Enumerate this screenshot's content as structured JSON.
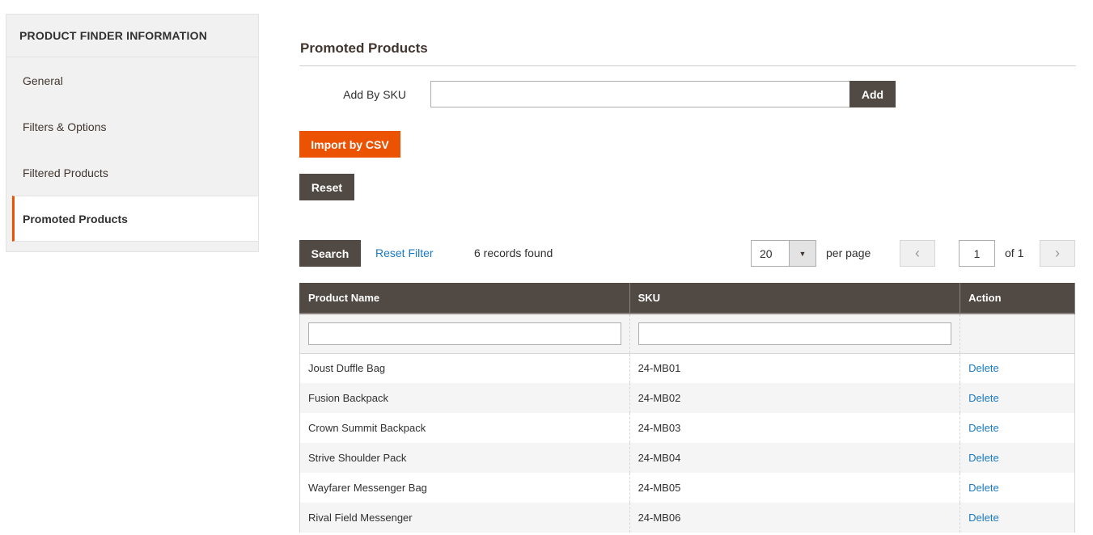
{
  "sidebar": {
    "title": "PRODUCT FINDER INFORMATION",
    "items": [
      {
        "label": "General"
      },
      {
        "label": "Filters & Options"
      },
      {
        "label": "Filtered Products"
      },
      {
        "label": "Promoted Products",
        "active": true
      }
    ]
  },
  "main": {
    "title": "Promoted Products",
    "add_by_sku_label": "Add By SKU",
    "sku_input_value": "",
    "add_button": "Add",
    "import_button": "Import by CSV",
    "reset_button": "Reset"
  },
  "toolbar": {
    "search_button": "Search",
    "reset_filter_link": "Reset Filter",
    "records_found": "6 records found",
    "per_page_value": "20",
    "per_page_label": "per page",
    "prev_icon": "‹",
    "next_icon": "›",
    "current_page": "1",
    "page_total": "of 1"
  },
  "grid": {
    "columns": [
      "Product Name",
      "SKU",
      "Action"
    ],
    "filters": {
      "product_name": "",
      "sku": ""
    },
    "rows": [
      {
        "name": "Joust Duffle Bag",
        "sku": "24-MB01",
        "action": "Delete"
      },
      {
        "name": "Fusion Backpack",
        "sku": "24-MB02",
        "action": "Delete"
      },
      {
        "name": "Crown Summit Backpack",
        "sku": "24-MB03",
        "action": "Delete"
      },
      {
        "name": "Strive Shoulder Pack",
        "sku": "24-MB04",
        "action": "Delete"
      },
      {
        "name": "Wayfarer Messenger Bag",
        "sku": "24-MB05",
        "action": "Delete"
      },
      {
        "name": "Rival Field Messenger",
        "sku": "24-MB06",
        "action": "Delete"
      }
    ]
  },
  "colors": {
    "accent": "#eb5202",
    "dark_button": "#514943",
    "link": "#1979c3"
  }
}
